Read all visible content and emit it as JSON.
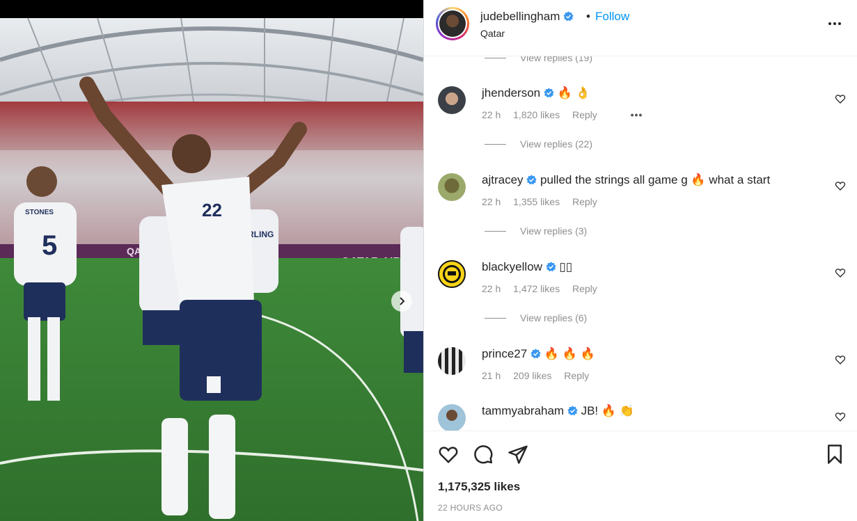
{
  "post": {
    "username": "judebellingham",
    "follow_label": "Follow",
    "dot": "•",
    "location": "Qatar",
    "photo_overlay_text": {
      "stones": "STONES",
      "stones_number": "5",
      "jude_number": "22",
      "sterling": "ERLING",
      "qatar": "QATAR AIRWAYS",
      "qa": "QA"
    }
  },
  "comments": {
    "top_view_replies": "View replies (19)",
    "items": [
      {
        "username": "jhenderson",
        "text": "🔥 👌",
        "time": "22 h",
        "likes": "1,820 likes",
        "reply": "Reply",
        "dots": "•••",
        "view_replies": "View replies (22)"
      },
      {
        "username": "ajtracey",
        "text": "pulled the strings all game g 🔥 what a start",
        "time": "22 h",
        "likes": "1,355 likes",
        "reply": "Reply",
        "view_replies": "View replies (3)"
      },
      {
        "username": "blackyellow",
        "text": "▯▯",
        "time": "22 h",
        "likes": "1,472 likes",
        "reply": "Reply",
        "view_replies": "View replies (6)"
      },
      {
        "username": "prince27",
        "text": "🔥 🔥 🔥",
        "time": "21 h",
        "likes": "209 likes",
        "reply": "Reply"
      },
      {
        "username": "tammyabraham",
        "text": "JB! 🔥 👏"
      }
    ]
  },
  "footer": {
    "likes": "1,175,325 likes",
    "time_ago": "22 HOURS AGO"
  },
  "colors": {
    "accent": "#0095f6",
    "verified": "#3897f0",
    "muted": "#8e8e8e",
    "text": "#262626"
  },
  "icons": {
    "verified": "verified-badge-icon",
    "more": "more-options-icon",
    "heart": "heart-icon",
    "comment": "comment-icon",
    "share": "share-icon",
    "save": "bookmark-icon",
    "next": "chevron-right-icon"
  }
}
